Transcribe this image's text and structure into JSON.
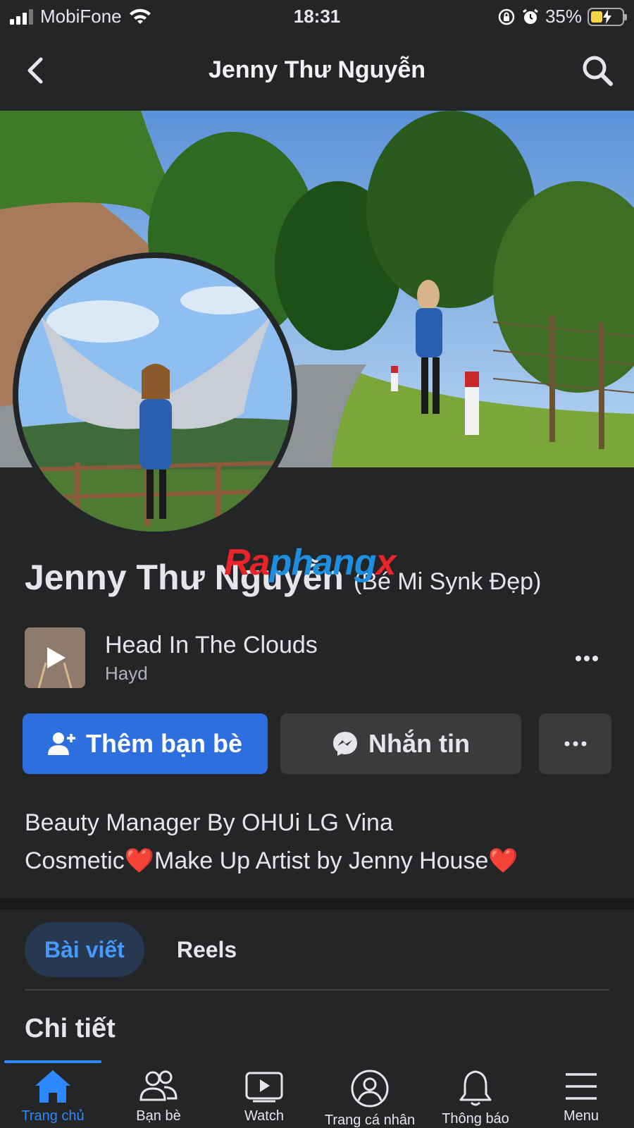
{
  "status_bar": {
    "carrier": "MobiFone",
    "time": "18:31",
    "battery": "35%",
    "battery_level": 0.35
  },
  "header": {
    "title": "Jenny Thư Nguyễn",
    "back_icon": "chevron-left-icon",
    "search_icon": "search-icon"
  },
  "profile": {
    "name": "Jenny Thư Nguyễn",
    "alt_name": "(Bé Mi Synk Đẹp)",
    "watermark": {
      "part1": "Ra",
      "part2": "phang",
      "part3": "x"
    }
  },
  "music": {
    "title": "Head In The Clouds",
    "artist": "Hayd"
  },
  "actions": {
    "add_friend": "Thêm bạn bè",
    "message": "Nhắn tin"
  },
  "bio": {
    "line1": "Beauty Manager By OHUi LG Vina",
    "line2": "Cosmetic❤️Make Up Artist by Jenny House❤️"
  },
  "tabs": [
    {
      "label": "Bài viết",
      "active": true
    },
    {
      "label": "Reels",
      "active": false
    }
  ],
  "section_title": "Chi tiết",
  "bottom_nav": [
    {
      "label": "Trang chủ",
      "icon": "home-icon",
      "active": true
    },
    {
      "label": "Bạn bè",
      "icon": "friends-icon",
      "active": false
    },
    {
      "label": "Watch",
      "icon": "watch-icon",
      "active": false
    },
    {
      "label": "Trang cá nhân",
      "icon": "profile-icon",
      "active": false
    },
    {
      "label": "Thông báo",
      "icon": "bell-icon",
      "active": false
    },
    {
      "label": "Menu",
      "icon": "menu-icon",
      "active": false
    }
  ],
  "colors": {
    "background": "#242526",
    "accent": "#2e6fe0",
    "active_blue": "#2d88ff"
  }
}
